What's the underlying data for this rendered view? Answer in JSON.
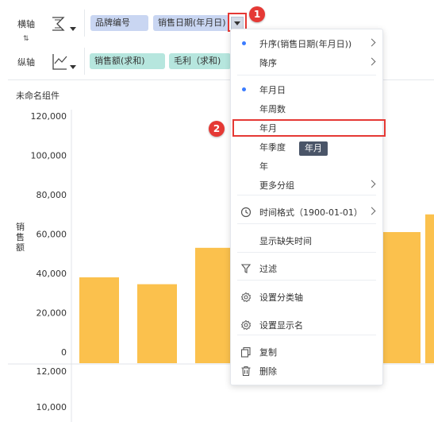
{
  "x_axis": {
    "label": "横轴",
    "icon": "dimension-axis-icon",
    "fields": [
      "品牌编号",
      "销售日期(年月日)"
    ],
    "callout": "1"
  },
  "y_axis": {
    "label": "纵轴",
    "icon": "measure-axis-icon",
    "fields": [
      "销售额(求和)",
      "毛利（求和)"
    ]
  },
  "swap_icon": "swap-icon",
  "component_title": "未命名组件",
  "chart_data": [
    {
      "type": "bar",
      "ylabel": "销售额",
      "ylim": [
        0,
        120000
      ],
      "yticks": [
        "120,000",
        "100,000",
        "80,000",
        "60,000",
        "40,000",
        "20,000",
        "0"
      ],
      "values": [
        38000,
        34500,
        53000,
        61000,
        70000
      ],
      "bar_color": "#fbc14d"
    },
    {
      "type": "bar",
      "yticks": [
        "12,000",
        "10,000"
      ]
    }
  ],
  "menu": {
    "items": [
      {
        "label": "升序(销售日期(年月日))",
        "dot": true,
        "arrow": true
      },
      {
        "label": "降序",
        "arrow": true
      },
      {
        "label": "年月日",
        "dot": true
      },
      {
        "label": "年周数"
      },
      {
        "label": "年月"
      },
      {
        "label": "年季度"
      },
      {
        "label": "年"
      },
      {
        "label": "更多分组",
        "arrow": true
      },
      {
        "label": "时间格式（1900-01-01）",
        "arrow": true,
        "icon": "clock-icon"
      },
      {
        "label": "显示缺失时间"
      },
      {
        "label": "过滤",
        "icon": "filter-icon"
      },
      {
        "label": "设置分类轴",
        "icon": "gear-icon"
      },
      {
        "label": "设置显示名",
        "icon": "gear-icon"
      },
      {
        "label": "复制",
        "icon": "copy-icon"
      },
      {
        "label": "删除",
        "icon": "trash-icon"
      }
    ],
    "callout": "2",
    "tooltip": "年月"
  }
}
